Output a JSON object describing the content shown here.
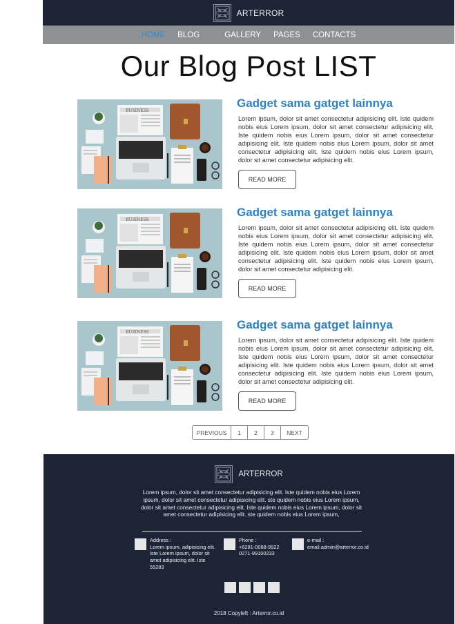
{
  "header": {
    "brand": "ARTERROR",
    "nav": [
      {
        "label": "HOME",
        "active": true
      },
      {
        "label": "BLOG",
        "active": false
      },
      {
        "label": "GALLERY",
        "active": false
      },
      {
        "label": "PAGES",
        "active": false
      },
      {
        "label": "CONTACTS",
        "active": false
      }
    ]
  },
  "page_title": "Our Blog Post LIST",
  "posts": [
    {
      "title": "Gadget sama gatget lainnya",
      "excerpt": "Lorem ipsum, dolor sit amet consectetur adipisicing elit. Iste quidem nobis eius Lorem ipsum,  dolor sit amet consectetur adipisicing elit. Iste quidem nobis eius Lorem ipsum, dolor sit amet consectetur adipisicing elit. Iste quidem nobis eius Lorem ipsum, dolor sit amet consectetur adipisicing elit. Iste quidem nobis eius Lorem ipsum, dolor sit amet consectetur adipisicing elit.",
      "button": "READ MORE",
      "image_label": "BUSINESS"
    },
    {
      "title": "Gadget sama gatget lainnya",
      "excerpt": "Lorem ipsum, dolor sit amet consectetur adipisicing elit. Iste quidem nobis eius Lorem ipsum,  dolor sit amet consectetur adipisicing elit. Iste quidem nobis eius Lorem ipsum, dolor sit amet consectetur adipisicing elit. Iste quidem nobis eius Lorem ipsum, dolor sit amet consectetur adipisicing elit. Iste quidem nobis eius Lorem ipsum, dolor sit amet consectetur adipisicing elit.",
      "button": "READ MORE",
      "image_label": "BUSINESS"
    },
    {
      "title": "Gadget sama gatget lainnya",
      "excerpt": "Lorem ipsum, dolor sit amet consectetur adipisicing elit. Iste quidem nobis eius Lorem ipsum,  dolor sit amet consectetur adipisicing elit. Iste quidem nobis eius Lorem ipsum, dolor sit amet consectetur adipisicing elit. Iste quidem nobis eius Lorem ipsum, dolor sit amet consectetur adipisicing elit. Iste quidem nobis eius Lorem ipsum, dolor sit amet consectetur adipisicing elit.",
      "button": "READ MORE",
      "image_label": "BUSINESS"
    }
  ],
  "pagination": {
    "previous": "PREVIOUS",
    "pages": [
      "1",
      "2",
      "3"
    ],
    "next": "NEXT"
  },
  "footer": {
    "brand": "ARTERROR",
    "text": "Lorem ipsum, dolor sit amet consectetur adipisicing elit. Iste quidem nobis eius Lorem ipsum, dolor sit amet consectetur adipisicing elit. ste quidem nobis eius Lorem ipsum,  dolor sit amet consectetur adipisicing elit. Iste quidem nobis eius Lorem ipsum, dolor sit amet consectetur adipisicing elit. ste quidem nobis eius  Lorem ipsum,",
    "address_label": "Address :",
    "address_value": "Lorem ipsum, adipisicing elit. Iste Lorem ipsum, dolor sit amet adipisicing elit. Iste 55283",
    "phone_label": "Phone :",
    "phone_value_1": "+6281-0088-9922",
    "phone_value_2": "0271-99100233",
    "email_label": "e-mail :",
    "email_value": "email.admin@arterror.co.id",
    "copyright": "2018 Copyleft : Arterror.co.id"
  },
  "colors": {
    "header_bg": "#1d2436",
    "nav_bg": "#8e9194",
    "accent": "#2f7fc4",
    "nav_active": "#2d8ad8"
  }
}
